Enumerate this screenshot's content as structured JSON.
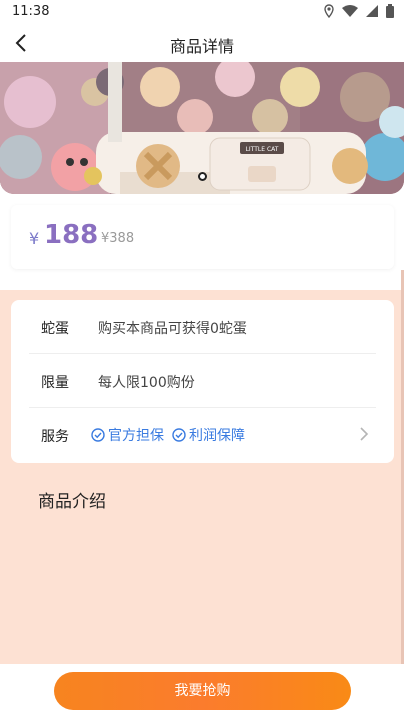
{
  "status_bar": {
    "time": "11:38",
    "icons": [
      "location-icon",
      "wifi-icon",
      "signal-icon",
      "battery-icon"
    ]
  },
  "nav": {
    "title": "商品详情",
    "back_icon": "chevron-left-icon"
  },
  "hero": {
    "sign_text": "LITTLE CAT"
  },
  "price": {
    "symbol": "¥",
    "value": "188",
    "original": "¥388"
  },
  "info": {
    "rows": [
      {
        "label": "蛇蛋",
        "value": "购买本商品可获得0蛇蛋"
      },
      {
        "label": "限量",
        "value": "每人限100购份"
      },
      {
        "label": "服务",
        "tags": [
          "官方担保",
          "利润保障"
        ]
      }
    ]
  },
  "intro": {
    "title": "商品介绍"
  },
  "bottom": {
    "buy_label": "我要抢购"
  },
  "colors": {
    "accent": "#f7841f",
    "peach": "#fde1d3",
    "tag_blue": "#3a7be0",
    "price_purple": "#8a6fc0"
  }
}
